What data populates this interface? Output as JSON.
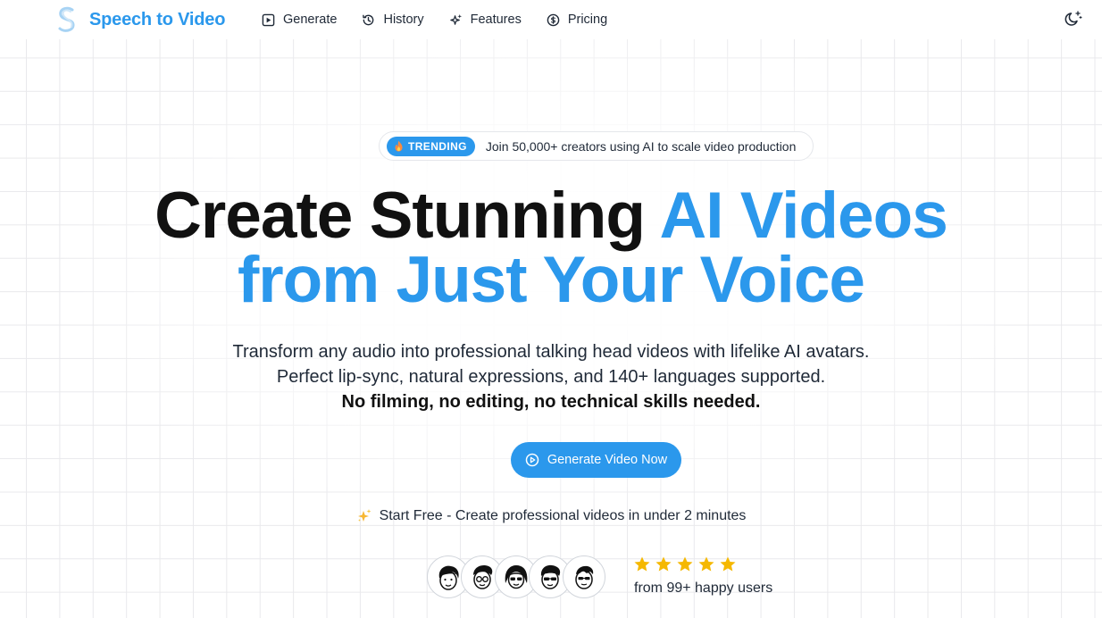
{
  "app": {
    "name": "Speech to Video"
  },
  "nav": [
    {
      "label": "Generate",
      "icon": "play-square-icon"
    },
    {
      "label": "History",
      "icon": "history-icon"
    },
    {
      "label": "Features",
      "icon": "sparkles-icon"
    },
    {
      "label": "Pricing",
      "icon": "dollar-circle-icon"
    }
  ],
  "theme_toggle": {
    "icon": "moon-stars-icon"
  },
  "badge": {
    "pill": "TRENDING",
    "pill_icon": "fire-icon",
    "text": "Join 50,000+ creators using AI to scale video production"
  },
  "hero": {
    "line1_dark": "Create Stunning ",
    "line1_blue": "AI Videos",
    "line2_blue": "from Just Your Voice",
    "sub1": "Transform any audio into professional talking head videos with lifelike AI avatars.",
    "sub2": "Perfect lip-sync, natural expressions, and 140+ languages supported.",
    "sub3": "No filming, no editing, no technical skills needed."
  },
  "cta": {
    "label": "Generate Video Now",
    "icon": "play-circle-icon"
  },
  "start_free": {
    "icon": "sparkle-emoji",
    "text": "Start Free - Create professional videos in under 2 minutes"
  },
  "social_proof": {
    "rating": 5,
    "text": "from 99+ happy users"
  },
  "colors": {
    "accent": "#2b98ec",
    "star": "#f5b800",
    "text_dark": "#111111"
  }
}
